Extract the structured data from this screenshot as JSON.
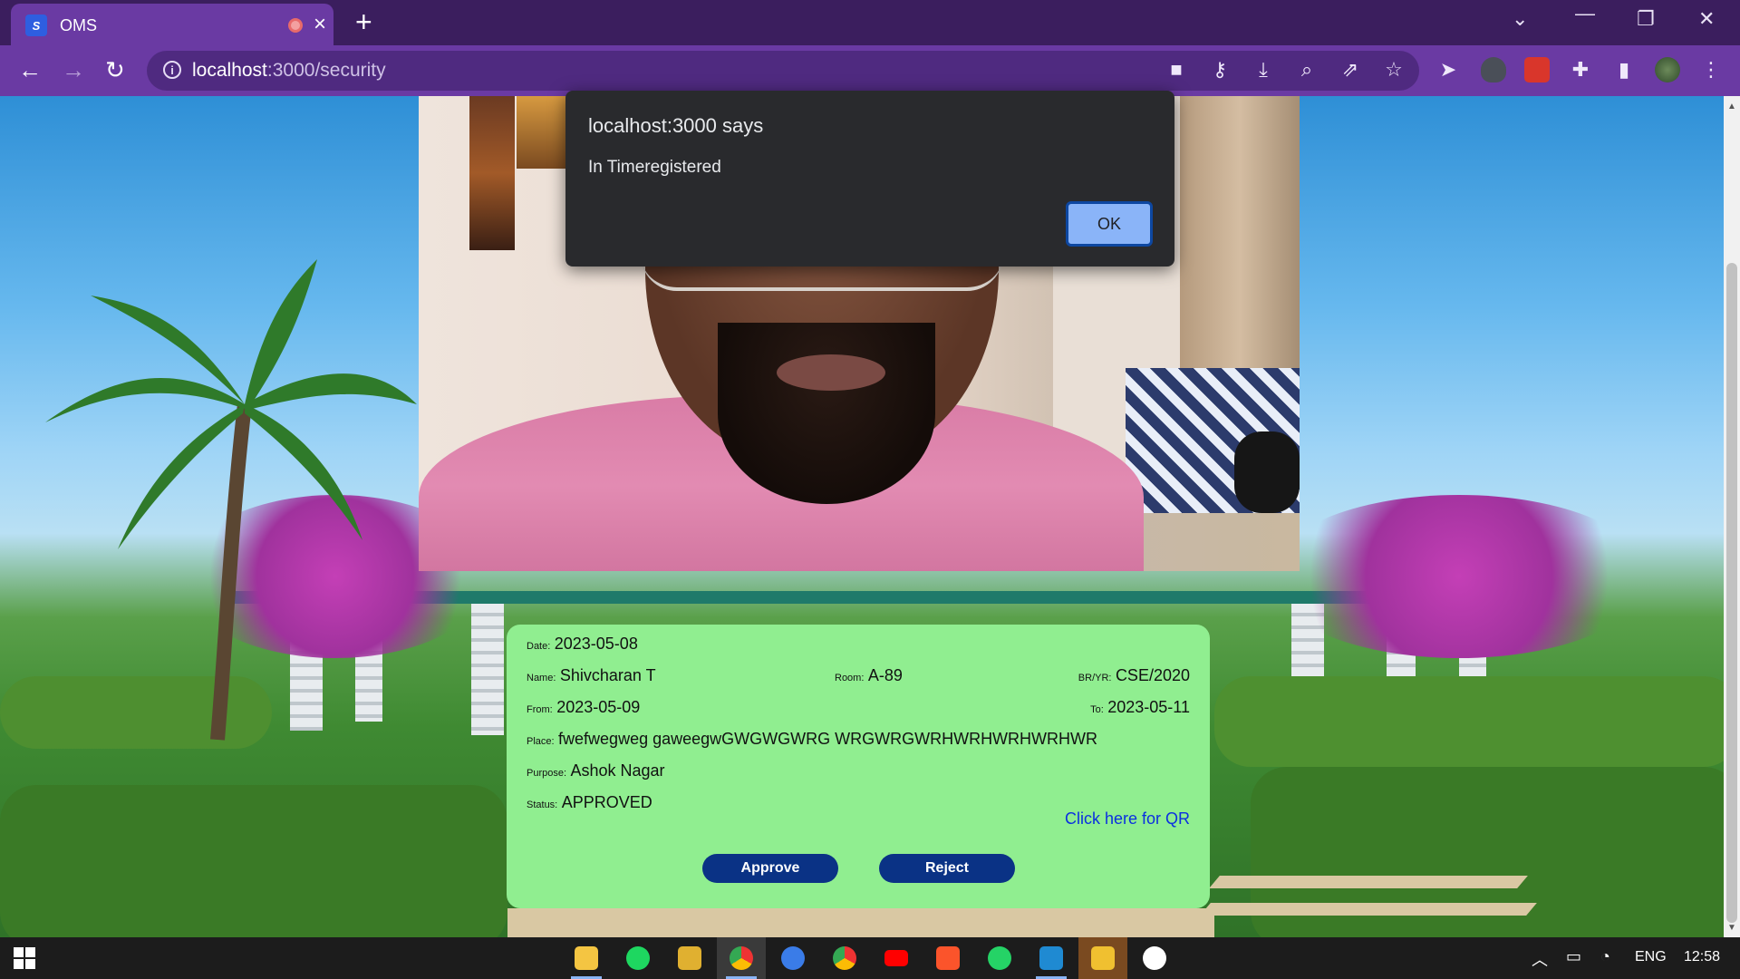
{
  "browser": {
    "tab_title": "OMS",
    "favicon_text": "S",
    "url_host": "localhost",
    "url_path": ":3000/security"
  },
  "dialog": {
    "title": "localhost:3000 says",
    "message": "In Timeregistered",
    "ok_label": "OK"
  },
  "card": {
    "date_label": "Date:",
    "date": "2023-05-08",
    "name_label": "Name:",
    "name": "Shivcharan T",
    "room_label": "Room:",
    "room": "A-89",
    "bryr_label": "BR/YR:",
    "bryr": "CSE/2020",
    "from_label": "From:",
    "from": "2023-05-09",
    "to_label": "To:",
    "to": "2023-05-11",
    "place_label": "Place:",
    "place": "fwefwegweg gaweegwGWGWGWRG WRGWRGWRHWRHWRHWRHWR",
    "purpose_label": "Purpose:",
    "purpose": "Ashok Nagar",
    "status_label": "Status:",
    "status": "APPROVED",
    "qr_link": "Click here for QR",
    "approve_label": "Approve",
    "reject_label": "Reject"
  },
  "taskbar": {
    "language": "ENG",
    "time": "12:58"
  },
  "colors": {
    "card_bg": "#90ee90",
    "button_bg": "#0a3285",
    "browser_accent": "#6a3aa3",
    "link": "#0b2fe0"
  }
}
